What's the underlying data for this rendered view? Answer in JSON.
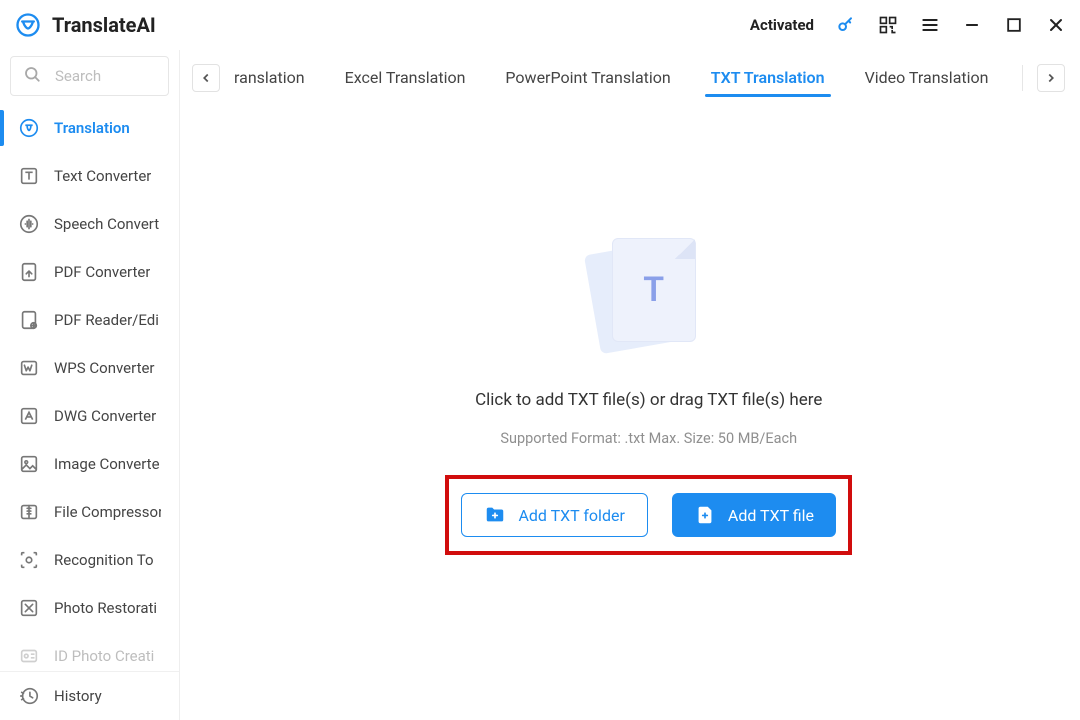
{
  "titlebar": {
    "brand": "TranslateAI",
    "activated_label": "Activated"
  },
  "search": {
    "placeholder": "Search"
  },
  "sidebar": {
    "items": [
      {
        "label": "Translation",
        "icon": "translate-icon",
        "active": true
      },
      {
        "label": "Text Converter",
        "icon": "text-convert-icon"
      },
      {
        "label": "Speech Convert",
        "icon": "speech-icon"
      },
      {
        "label": "PDF Converter",
        "icon": "pdf-convert-icon"
      },
      {
        "label": "PDF Reader/Edi",
        "icon": "pdf-reader-icon"
      },
      {
        "label": "WPS Converter",
        "icon": "wps-icon"
      },
      {
        "label": "DWG Converter",
        "icon": "dwg-icon"
      },
      {
        "label": "Image Converte",
        "icon": "image-icon"
      },
      {
        "label": "File Compressor",
        "icon": "compress-icon"
      },
      {
        "label": "Recognition To",
        "icon": "recognition-icon"
      },
      {
        "label": "Photo Restorati",
        "icon": "photo-icon"
      },
      {
        "label": "ID Photo Creati",
        "icon": "idphoto-icon"
      }
    ],
    "bottom": {
      "label": "History",
      "icon": "history-icon"
    }
  },
  "tabs": {
    "items": [
      {
        "label": "ranslation"
      },
      {
        "label": "Excel Translation"
      },
      {
        "label": "PowerPoint Translation"
      },
      {
        "label": "TXT Translation",
        "active": true
      },
      {
        "label": "Video Translation"
      }
    ]
  },
  "main": {
    "illustration_letter": "T",
    "drop_text": "Click to add TXT file(s) or drag TXT file(s) here",
    "support_text": "Supported Format: .txt Max. Size: 50 MB/Each",
    "add_folder_label": "Add TXT folder",
    "add_file_label": "Add TXT file"
  },
  "colors": {
    "accent": "#1d8cf0",
    "highlight_box": "#d10d0d"
  }
}
